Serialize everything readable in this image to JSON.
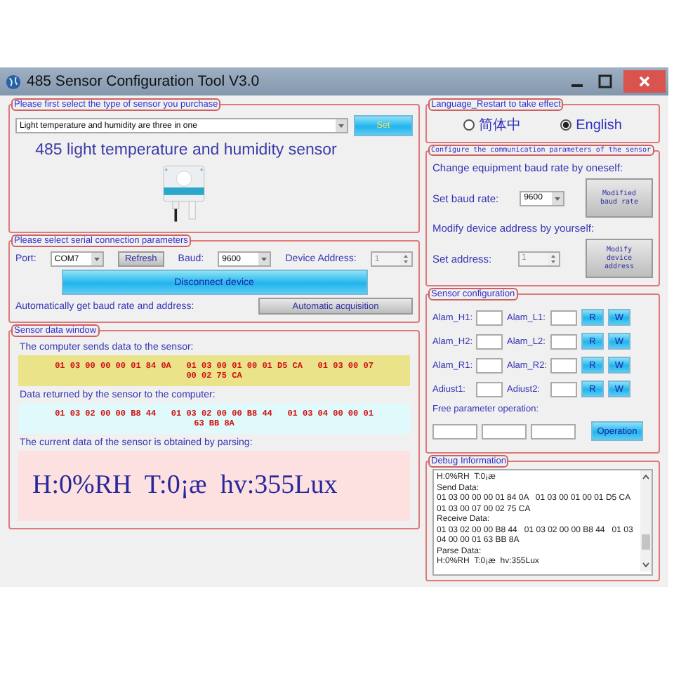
{
  "window": {
    "title": "485 Sensor Configuration Tool V3.0"
  },
  "sensor_type": {
    "legend": "Please first select the type of sensor you purchase",
    "selected_type": "Light temperature and humidity are three in one",
    "set_button": "Set",
    "heading": "485 light temperature and humidity sensor"
  },
  "serial": {
    "legend": "Please select serial connection parameters",
    "port_label": "Port:",
    "port": "COM7",
    "refresh": "Refresh",
    "baud_label": "Baud:",
    "baud": "9600",
    "address_label": "Device Address:",
    "address": "1",
    "disconnect": "Disconnect device",
    "auto_label": "Automatically get baud rate and address:",
    "auto_button": "Automatic acquisition"
  },
  "data_window": {
    "legend": "Sensor data window",
    "sent_label": "The computer sends data to the sensor:",
    "sent": "01 03 00 00 00 01 84 0A   01 03 00 01 00 01 D5 CA   01 03 00 07 00 02 75 CA",
    "received_label": "Data returned by the sensor to the computer:",
    "received": "01 03 02 00 00 B8 44   01 03 02 00 00 B8 44   01 03 04 00 00 01 63 BB 8A",
    "parsed_label": "The current data of the sensor is obtained by parsing:",
    "parsed": "H:0%RH  T:0¡æ  hv:355Lux"
  },
  "language": {
    "legend": "Language_Restart to take effect",
    "options": [
      {
        "label": "简体中",
        "selected": false
      },
      {
        "label": "English",
        "selected": true
      }
    ]
  },
  "comm": {
    "legend": "Configure the communication parameters of the sensor",
    "baud_heading": "Change equipment baud rate by oneself:",
    "baud_label": "Set baud rate:",
    "baud_value": "9600",
    "baud_button": "Modified baud rate",
    "address_heading": "Modify device address by yourself:",
    "address_label": "Set address:",
    "address_value": "1",
    "address_button": "Modify device address"
  },
  "sensor_config": {
    "legend": "Sensor configuration",
    "rows": [
      {
        "left": "Alam_H1:",
        "right": "Alam_L1:",
        "read": "R",
        "write": "W"
      },
      {
        "left": "Alam_H2:",
        "right": "Alam_L2:",
        "read": "R",
        "write": "W"
      },
      {
        "left": "Alam_R1:",
        "right": "Alam_R2:",
        "read": "R",
        "write": "W"
      },
      {
        "left": "Adiust1:",
        "right": "Adiust2:",
        "read": "R",
        "write": "W"
      }
    ],
    "free_label": "Free parameter operation:",
    "operation": "Operation"
  },
  "debug": {
    "legend": "Debug Information",
    "lines": [
      "H:0%RH  T:0¡æ",
      "Send Data:",
      "01 03 00 00 00 01 84 0A   01 03 00 01 00 01 D5 CA",
      "01 03 00 07 00 02 75 CA",
      "Receive Data:",
      "01 03 02 00 00 B8 44   01 03 02 00 00 B8 44   01 03",
      "04 00 00 01 63 BB 8A",
      "Parse Data:",
      "H:0%RH  T:0¡æ  hv:355Lux"
    ]
  }
}
